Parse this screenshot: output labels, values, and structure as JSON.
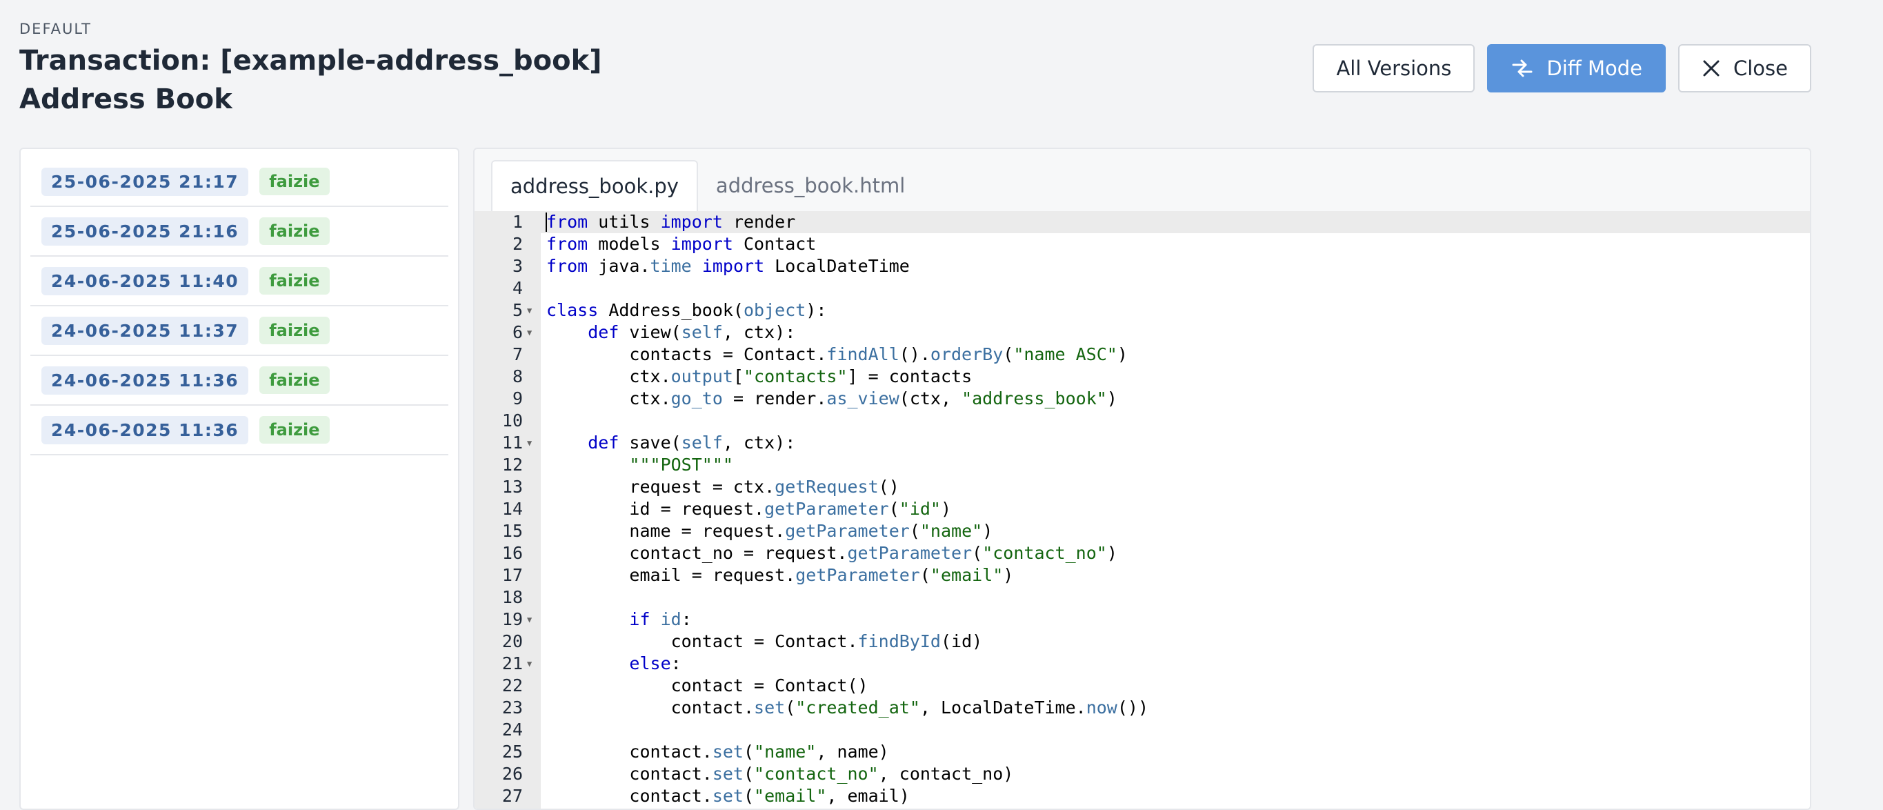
{
  "header": {
    "eyebrow": "DEFAULT",
    "title": "Transaction: [example-address_book] Address Book"
  },
  "actions": {
    "all_versions": "All Versions",
    "diff_mode": "Diff Mode",
    "close": "Close"
  },
  "history": [
    {
      "date": "25-06-2025 21:17",
      "user": "faizie"
    },
    {
      "date": "25-06-2025 21:16",
      "user": "faizie"
    },
    {
      "date": "24-06-2025 11:40",
      "user": "faizie"
    },
    {
      "date": "24-06-2025 11:37",
      "user": "faizie"
    },
    {
      "date": "24-06-2025 11:36",
      "user": "faizie"
    },
    {
      "date": "24-06-2025 11:36",
      "user": "faizie"
    }
  ],
  "tabs": [
    {
      "label": "address_book.py",
      "active": true
    },
    {
      "label": "address_book.html",
      "active": false
    }
  ],
  "code": {
    "active_line": 1,
    "fold_lines": [
      5,
      6,
      11,
      19,
      21
    ],
    "lines": [
      "from utils import render",
      "from models import Contact",
      "from java.time import LocalDateTime",
      "",
      "class Address_book(object):",
      "    def view(self, ctx):",
      "        contacts = Contact.findAll().orderBy(\"name ASC\")",
      "        ctx.output[\"contacts\"] = contacts",
      "        ctx.go_to = render.as_view(ctx, \"address_book\")",
      "",
      "    def save(self, ctx):",
      "        \"\"\"POST\"\"\"",
      "        request = ctx.getRequest()",
      "        id = request.getParameter(\"id\")",
      "        name = request.getParameter(\"name\")",
      "        contact_no = request.getParameter(\"contact_no\")",
      "        email = request.getParameter(\"email\")",
      "",
      "        if id:",
      "            contact = Contact.findById(id)",
      "        else:",
      "            contact = Contact()",
      "            contact.set(\"created_at\", LocalDateTime.now())",
      "",
      "        contact.set(\"name\", name)",
      "        contact.set(\"contact_no\", contact_no)",
      "        contact.set(\"email\", email)"
    ]
  }
}
